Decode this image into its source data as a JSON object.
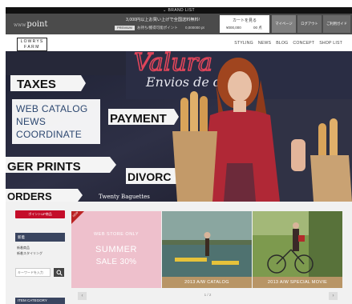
{
  "brand_strip": {
    "label": "BRAND LIST",
    "chevron": "chevron-down-icon"
  },
  "header": {
    "site_logo_prefix": "www",
    "site_logo": "point",
    "promo": "3,000円以上お買い上げで全国送料無料!",
    "member_tag": "PREMIUM",
    "member_text": "お持ち/獲得可能ポイント",
    "member_points": "0,000000 pt",
    "cart_label": "カートを見る",
    "cart_total": "¥000,000",
    "cart_count": "00 点",
    "buttons": [
      "マイページ",
      "ログアウト",
      "ご利用ガイド"
    ]
  },
  "brand": {
    "logo_line1": "LOWRYS",
    "logo_line2": "FARM",
    "nav": [
      "STYLING",
      "NEWS",
      "BLOG",
      "CONCEPT",
      "SHOP LIST"
    ]
  },
  "hero": {
    "menu": [
      "WEB CATALOG",
      "NEWS",
      "COORDINATE"
    ],
    "signs": [
      "TAXES",
      "PAYMENT",
      "GER PRINTS",
      "ORDERS",
      "DIVORC"
    ],
    "neon": "Valura",
    "script_text": "Envios de di",
    "caption": "Twenty Baguettes"
  },
  "sidebar": {
    "point_button": "ポイントUP商品",
    "section_head": "新着",
    "links": [
      "新着商品",
      "新着スタイリング"
    ],
    "search_placeholder": "キーワードを入力",
    "category_head": "ITEM CATEGORY"
  },
  "tiles": [
    {
      "badge": "NEW",
      "line1": "WEB STORE ONLY",
      "line2": "SUMMER",
      "line3": "SALE 30%"
    },
    {
      "caption": "2013 A/W CATALOG"
    },
    {
      "caption": "2013 A/W SPECIAL MOVIE"
    }
  ],
  "pager": {
    "count": "1 / 2",
    "prev": "‹",
    "next": "›"
  },
  "colors": {
    "header_bg": "#4b4b4b",
    "menu_text": "#2c4770",
    "point_red": "#c40d2a",
    "sidebar_navy": "#3a4560",
    "sale_pink": "#eec0cc",
    "caption_tan": "#b89566"
  }
}
